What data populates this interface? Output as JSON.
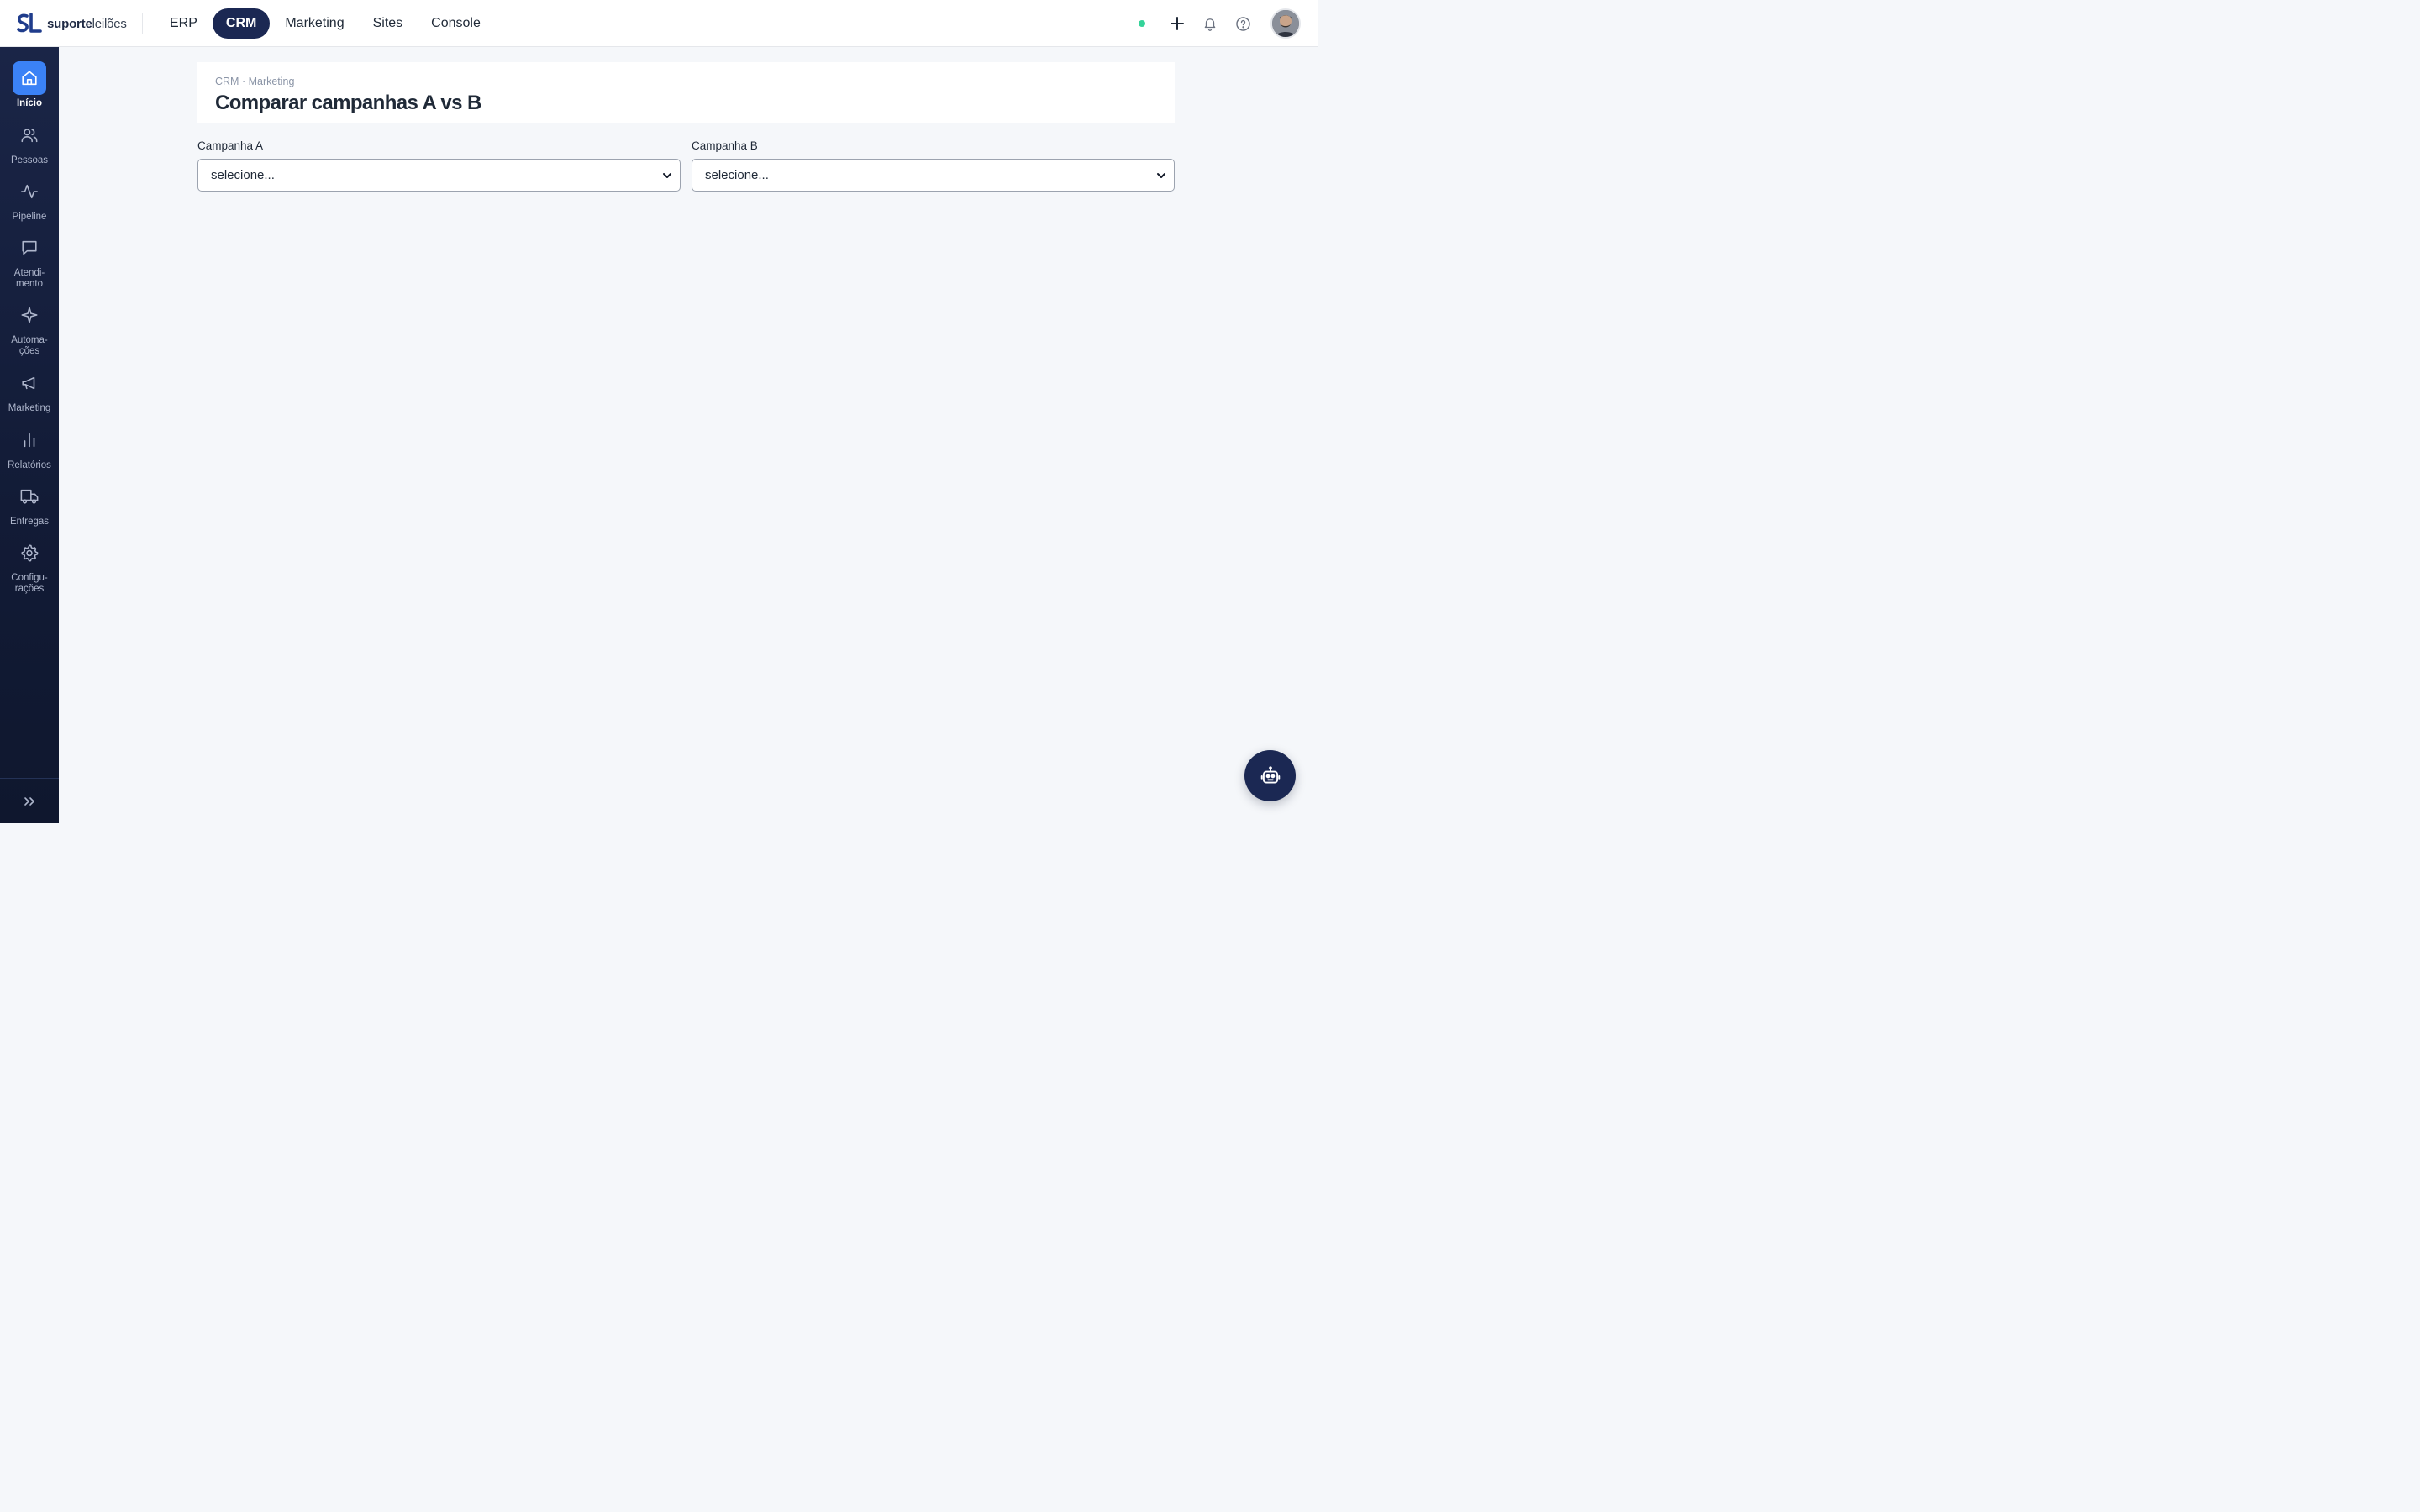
{
  "logo": {
    "mark": "SL",
    "word_bold": "suporte",
    "word_light": "leilões"
  },
  "topnav": {
    "tabs": [
      "ERP",
      "CRM",
      "Marketing",
      "Sites",
      "Console"
    ],
    "active": "CRM"
  },
  "top_actions": {
    "status": "online",
    "icons": [
      "plus-icon",
      "bell-icon",
      "help-icon"
    ],
    "avatar": "user-avatar"
  },
  "sidebar": {
    "items": [
      {
        "id": "inicio",
        "label": "Início",
        "icon": "home-icon",
        "active": true
      },
      {
        "id": "pessoas",
        "label": "Pessoas",
        "icon": "users-icon"
      },
      {
        "id": "pipeline",
        "label": "Pipeline",
        "icon": "activity-icon"
      },
      {
        "id": "atendimento",
        "label": "Atendi-\nmento",
        "icon": "chat-icon"
      },
      {
        "id": "automacoes",
        "label": "Automa-\nções",
        "icon": "sparkle-icon"
      },
      {
        "id": "marketing",
        "label": "Marketing",
        "icon": "megaphone-icon"
      },
      {
        "id": "relatorios",
        "label": "Relatórios",
        "icon": "bar-chart-icon"
      },
      {
        "id": "entregas",
        "label": "Entregas",
        "icon": "truck-icon"
      },
      {
        "id": "configuracoes",
        "label": "Configu-\nrações",
        "icon": "gear-icon"
      }
    ],
    "collapse_icon": "chevrons-right-icon"
  },
  "header": {
    "breadcrumb": "CRM · Marketing",
    "title": "Comparar campanhas A vs B"
  },
  "form": {
    "campaign_a": {
      "label": "Campanha A",
      "value": "selecione..."
    },
    "campaign_b": {
      "label": "Campanha B",
      "value": "selecione..."
    }
  },
  "assistant": {
    "icon": "robot-icon"
  },
  "colors": {
    "brand_navy": "#1b2853",
    "active_blue": "#3b82f6",
    "status_green": "#34d399",
    "background": "#f5f7fa"
  }
}
